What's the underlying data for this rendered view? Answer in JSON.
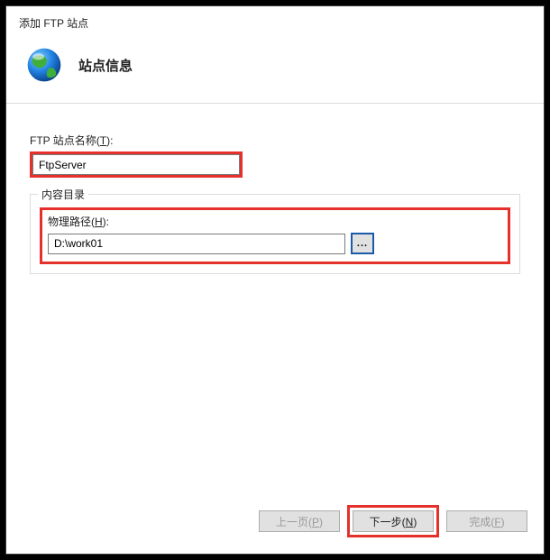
{
  "window": {
    "title": "添加 FTP 站点"
  },
  "header": {
    "heading": "站点信息"
  },
  "form": {
    "siteNameLabelPrefix": "FTP 站点名称(",
    "siteNameHotkey": "T",
    "siteNameLabelSuffix": "):",
    "siteNameValue": "FtpServer",
    "contentDirGroup": "内容目录",
    "physicalPathLabelPrefix": "物理路径(",
    "physicalPathHotkey": "H",
    "physicalPathLabelSuffix": "):",
    "physicalPathValue": "D:\\work01",
    "browseLabel": "..."
  },
  "footer": {
    "prevPrefix": "上一页(",
    "prevHotkey": "P",
    "prevSuffix": ")",
    "nextPrefix": "下一步(",
    "nextHotkey": "N",
    "nextSuffix": ")",
    "finishPrefix": "完成(",
    "finishHotkey": "F",
    "finishSuffix": ")"
  }
}
